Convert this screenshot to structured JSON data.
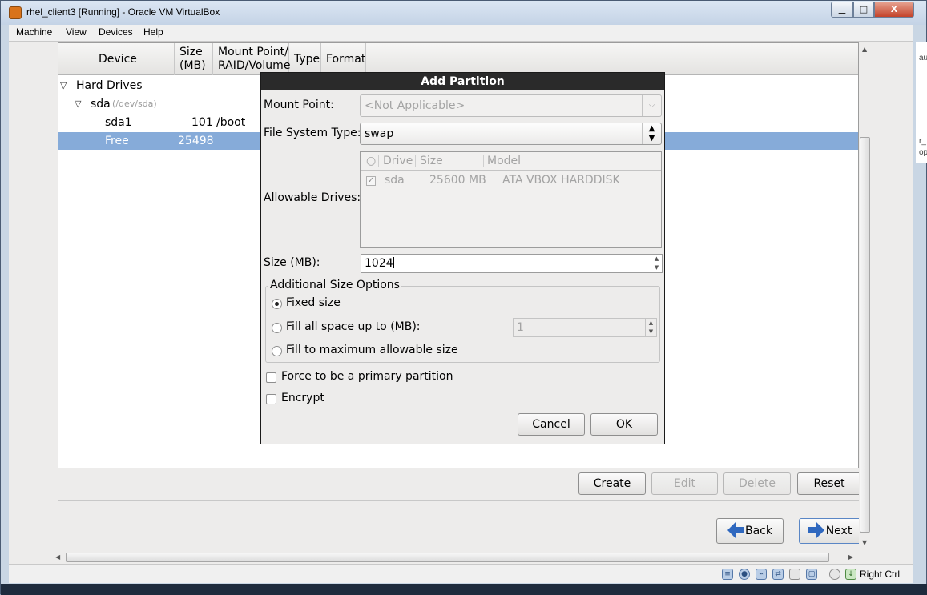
{
  "window": {
    "title": "rhel_client3 [Running] - Oracle VM VirtualBox",
    "minimize": "▁",
    "maximize": "□",
    "close": "X"
  },
  "menu": [
    "Machine",
    "View",
    "Devices",
    "Help"
  ],
  "table": {
    "headers": {
      "device": "Device",
      "size_line1": "Size",
      "size_line2": "(MB)",
      "mount_line1": "Mount Point/",
      "mount_line2": "RAID/Volume",
      "type": "Type",
      "format": "Format"
    },
    "rows": [
      {
        "expander": "▽",
        "device": "Hard Drives",
        "size": "",
        "mount": ""
      },
      {
        "expander": "▽",
        "device": "sda",
        "path": "(/dev/sda)",
        "size": "",
        "mount": ""
      },
      {
        "expander": "",
        "device": "sda1",
        "size": "101",
        "mount": "/boot"
      },
      {
        "expander": "",
        "device": "Free",
        "size": "25498",
        "mount": ""
      }
    ]
  },
  "actions": {
    "create": "Create",
    "edit": "Edit",
    "delete": "Delete",
    "reset": "Reset",
    "back": "Back",
    "next": "Next"
  },
  "dialog": {
    "title": "Add Partition",
    "mount_point_label": "Mount Point:",
    "mount_point_value": "<Not Applicable>",
    "fs_type_label": "File System Type:",
    "fs_type_value": "swap",
    "allowable_drives_label": "Allowable Drives:",
    "drives_headers": [
      "Drive",
      "Size",
      "Model"
    ],
    "drives": [
      {
        "checked": true,
        "drive": "sda",
        "size": "25600 MB",
        "model": "ATA VBOX HARDDISK"
      }
    ],
    "size_label": "Size (MB):",
    "size_value": "1024",
    "additional_options_legend": "Additional Size Options",
    "options": {
      "fixed": "Fixed size",
      "fill_up_to": "Fill all space up to (MB):",
      "fill_up_to_value": "1",
      "fill_max": "Fill to maximum allowable size",
      "selected": "fixed"
    },
    "force_primary": "Force to be a primary partition",
    "encrypt": "Encrypt",
    "cancel": "Cancel",
    "ok": "OK"
  },
  "statusbar": {
    "right_ctrl": "Right Ctrl"
  },
  "outside_text": [
    "au",
    "r_",
    "op"
  ]
}
